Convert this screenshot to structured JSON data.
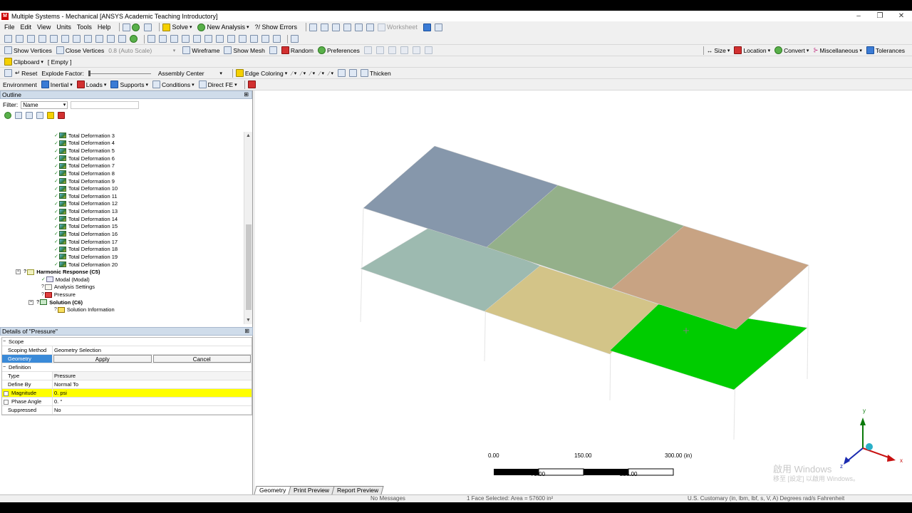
{
  "window": {
    "title": "Multiple Systems - Mechanical [ANSYS Academic Teaching Introductory]",
    "logo": "M",
    "minimize": "‒",
    "maximize": "❐",
    "close": "✕"
  },
  "menu": [
    "File",
    "Edit",
    "View",
    "Units",
    "Tools",
    "Help"
  ],
  "toolbar1": {
    "solve": "Solve",
    "new_analysis": "New Analysis",
    "show_errors": "?/ Show Errors",
    "worksheet": "Worksheet"
  },
  "toolbar3": {
    "show_vertices": "Show Vertices",
    "close_vertices": "Close Vertices",
    "auto_scale": "0.8 (Auto Scale)",
    "wireframe": "Wireframe",
    "show_mesh": "Show Mesh",
    "random": "Random",
    "preferences": "Preferences",
    "size": "Size",
    "location": "Location",
    "convert": "Convert",
    "misc": "Miscellaneous",
    "tolerances": "Tolerances"
  },
  "toolbar4": {
    "clipboard": "Clipboard",
    "empty": "[ Empty ]"
  },
  "toolbar5": {
    "reset": "Reset",
    "explode": "Explode Factor:",
    "assembly": "Assembly Center",
    "edge_coloring": "Edge Coloring",
    "thicken": "Thicken"
  },
  "toolbar6": {
    "environment": "Environment",
    "inertial": "Inertial",
    "loads": "Loads",
    "supports": "Supports",
    "conditions": "Conditions",
    "direct_fe": "Direct FE"
  },
  "outline": {
    "title": "Outline",
    "pin": "⊞",
    "filter_label": "Filter:",
    "filter_value": "Name",
    "deformations": [
      "Total Deformation 3",
      "Total Deformation 4",
      "Total Deformation 5",
      "Total Deformation 6",
      "Total Deformation 7",
      "Total Deformation 8",
      "Total Deformation 9",
      "Total Deformation 10",
      "Total Deformation 11",
      "Total Deformation 12",
      "Total Deformation 13",
      "Total Deformation 14",
      "Total Deformation 15",
      "Total Deformation 16",
      "Total Deformation 17",
      "Total Deformation 18",
      "Total Deformation 19",
      "Total Deformation 20"
    ],
    "harmonic": "Harmonic Response (C5)",
    "modal": "Modal (Modal)",
    "analysis_settings": "Analysis Settings",
    "pressure": "Pressure",
    "solution": "Solution (C6)",
    "solution_info": "Solution Information",
    "expand_minus": "−",
    "check": "✓",
    "question": "?"
  },
  "details": {
    "title": "Details of \"Pressure\"",
    "pin": "⊞",
    "scope": "Scope",
    "scoping_method_k": "Scoping Method",
    "scoping_method_v": "Geometry Selection",
    "geometry_k": "Geometry",
    "apply": "Apply",
    "cancel": "Cancel",
    "definition": "Definition",
    "type_k": "Type",
    "type_v": "Pressure",
    "define_by_k": "Define By",
    "define_by_v": "Normal To",
    "magnitude_k": "Magnitude",
    "magnitude_v": "0. psi",
    "phase_k": "Phase Angle",
    "phase_v": "0. °",
    "suppressed_k": "Suppressed",
    "suppressed_v": "No"
  },
  "scale": {
    "t0": "0.00",
    "t150": "150.00",
    "t300": "300.00 (in)",
    "t75": "75.00",
    "t225": "225.00"
  },
  "tabs": [
    "Geometry",
    "Print Preview",
    "Report Preview"
  ],
  "status": {
    "messages": "No Messages",
    "selection": "1 Face Selected: Area = 57600 in²",
    "units": "U.S. Customary (in, lbm, lbf, s, V, A)   Degrees   rad/s   Fahrenheit"
  },
  "watermark": {
    "line1": "啟用 Windows",
    "line2": "移至 [設定] 以啟用 Windows。"
  },
  "colors": {
    "selected_face": "#00cc00",
    "highlight": "#ffff00",
    "selection_blue": "#3a8ad8"
  }
}
